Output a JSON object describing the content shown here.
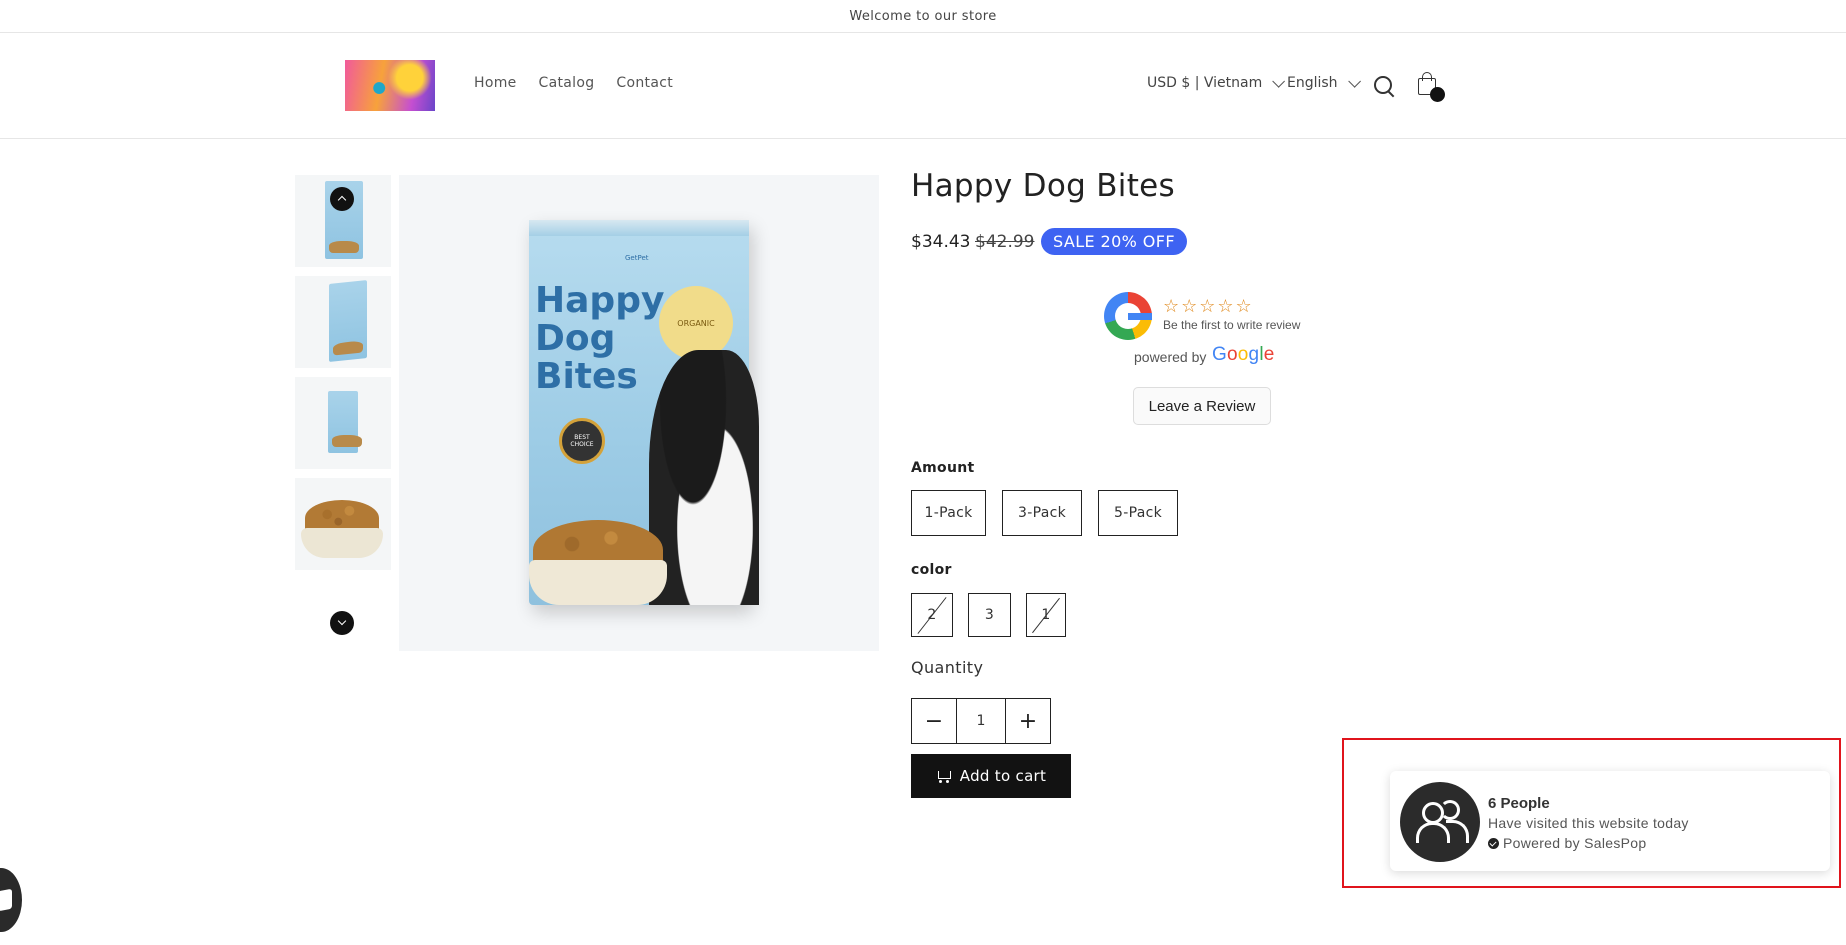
{
  "announcement": "Welcome to our store",
  "nav": {
    "items": [
      "Home",
      "Catalog",
      "Contact"
    ]
  },
  "header": {
    "currency": "USD $ | Vietnam",
    "language": "English"
  },
  "product": {
    "title": "Happy Dog Bites",
    "price": "$34.43",
    "compare_price": "$42.99",
    "sale_badge": "SALE 20% OFF",
    "package_text": "Happy Dog Bites"
  },
  "reviews": {
    "stars": "☆☆☆☆☆",
    "hint": "Be the first to write review",
    "powered_by": "powered by",
    "google": "Google",
    "leave_button": "Leave a Review"
  },
  "options": {
    "amount_label": "Amount",
    "amount_values": [
      "1-Pack",
      "3-Pack",
      "5-Pack"
    ],
    "color_label": "color",
    "color_values": [
      "2",
      "3",
      "1"
    ]
  },
  "quantity": {
    "label": "Quantity",
    "value": "1",
    "minus": "−",
    "plus": "+"
  },
  "add_to_cart": "Add to cart",
  "popup": {
    "title": "6 People",
    "subtitle": "Have visited this website today",
    "powered": "Powered by SalesPop"
  },
  "colors": {
    "sale_badge": "#3e63f2",
    "button": "#121212",
    "highlight_frame": "#e0141c"
  }
}
